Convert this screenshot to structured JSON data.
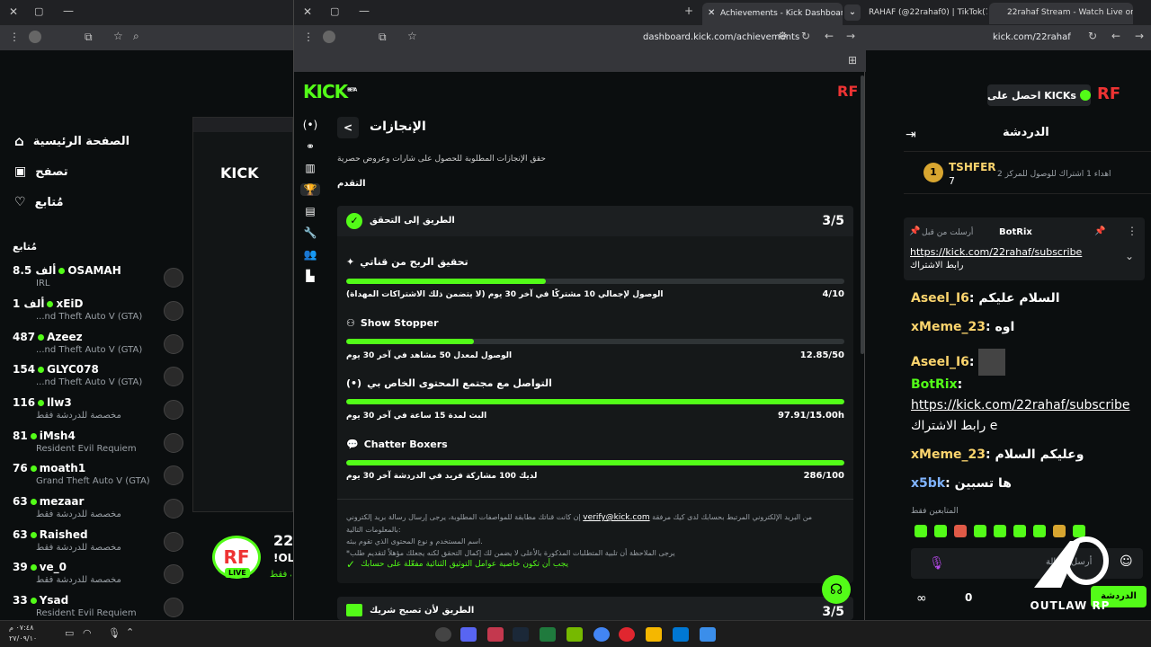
{
  "browser_back": {
    "tabs": [
      "RAHAF (@22rahaf0) | TikTok(7)",
      "22rahaf Stream - Watch Live on"
    ],
    "url": "kick.com/22rahaf"
  },
  "browser_front": {
    "tab_title": "Achievements - Kick Dashboard",
    "url": "dashboard.kick.com/achievements"
  },
  "kick": {
    "logo": "KICK",
    "beta": "BETA",
    "get_kicks_label": "احصل على KICKs",
    "channel_letters": "RF"
  },
  "left_nav": [
    {
      "label": "الصفحة الرئيسية",
      "icon": "home-icon"
    },
    {
      "label": "تصفح",
      "icon": "browse-icon"
    },
    {
      "label": "مُتابع",
      "icon": "heart-icon"
    }
  ],
  "following_title": "مُتابع",
  "following": [
    {
      "count": "8.5 ألف",
      "name": "OSAMAH",
      "sub": "IRL"
    },
    {
      "count": "1 ألف",
      "name": "xEiD",
      "sub": "...nd Theft Auto V (GTA)"
    },
    {
      "count": "487",
      "name": "Azeez",
      "sub": "...nd Theft Auto V (GTA)"
    },
    {
      "count": "154",
      "name": "GLYC078",
      "sub": "...nd Theft Auto V (GTA)"
    },
    {
      "count": "116",
      "name": "llw3",
      "sub": "مخصصة للدردشة فقط"
    },
    {
      "count": "81",
      "name": "iMsh4",
      "sub": "Resident Evil Requiem"
    },
    {
      "count": "76",
      "name": "moath1",
      "sub": "Grand Theft Auto V (GTA)"
    },
    {
      "count": "63",
      "name": "mezaar",
      "sub": "مخصصة للدردشة فقط"
    },
    {
      "count": "63",
      "name": "Raished",
      "sub": "مخصصة للدردشة فقط"
    },
    {
      "count": "39",
      "name": "ve_0",
      "sub": "مخصصة للدردشة فقط"
    },
    {
      "count": "33",
      "name": "Ysad",
      "sub": "Resident Evil Requiem"
    }
  ],
  "stream": {
    "live": "LIVE",
    "title_partial": "22",
    "sub_partial": "!OL",
    "sub2": "دقة فقط"
  },
  "page": {
    "back_label": "<",
    "title": "الإنجازات",
    "subtitle": "حقق الإنجازات المطلوبة للحصول على شارات وعروض حصرية",
    "progress_label": "التقدم"
  },
  "verify_card": {
    "title": "الطريق إلى التحقق",
    "score": "3/5",
    "achievements": [
      {
        "icon": "sparkle-icon",
        "title": "تحقيق الربح من قناتي",
        "desc": "الوصول لإجمالي 10 مشتركًا في آخر 30 يوم (لا يتضمن ذلك الاشتراكات المهداة)",
        "value": "4/10",
        "progress": 0.4
      },
      {
        "icon": "people-icon",
        "title": "Show Stopper",
        "desc": "الوصول لمعدل 50 مشاهد في آخر 30 يوم",
        "value": "12.85/50",
        "progress": 0.257
      },
      {
        "icon": "broadcast-icon",
        "title": "التواصل مع مجتمع المحتوى الخاص بي",
        "desc": "البث لمدة 15 ساعة في آخر 30 يوم",
        "value": "97.91/15.00h",
        "progress": 1.0
      },
      {
        "icon": "chat-icon",
        "title": "Chatter Boxers",
        "desc": "لديك 100 مشاركة فريد في الدردشة آخر 30 يوم",
        "value": "286/100",
        "progress": 1.0
      }
    ],
    "note_1": "إن كانت قناتك مطابقة للمواصفات المطلوبة، يرجى إرسال رسالة بريد إلكتروني",
    "note_email": "verify@kick.com",
    "note_1b": "من البريد الإلكتروني المرتبط بحسابك لدى كيك مرفقة بالمعلومات التالية:",
    "note_2": "اسم المستخدم و نوع المحتوى الذي تقوم ببثه.",
    "note_3": "*يرجى الملاحظة أن تلبية المتطلبات المذكورة بالأعلى لا يضمن لك إكمال التحقق لكنه يجعلك مؤهلاً لتقديم طلب",
    "twofa": "يجب أن تكون خاصية عوامل التوثيق الثنائية مفعّلة على حسابك"
  },
  "next_card": {
    "title": "الطريق لأن تصبح شريك",
    "score": "3/5"
  },
  "chat": {
    "title": "الدردشة",
    "top_user": "TSHFER",
    "top_count": "7",
    "top_text": "أهداء 1 اشتراك للوصول للمركز 2",
    "pinned_by": "أرسلت من قبل",
    "pinned_user": "BotRix",
    "pinned_link": "https://kick.com/22rahaf/subscribe",
    "pinned_text": "رابط الاشتراك",
    "messages": [
      {
        "user": "Aseel_I6",
        "text": "السلام عليكم",
        "color": "#fbd46d"
      },
      {
        "user": "xMeme_23",
        "text": "اوه",
        "color": "#fbd46d"
      },
      {
        "user": "Aseel_I6",
        "text": "",
        "color": "#fbd46d"
      },
      {
        "user": "BotRix",
        "text": "https://kick.com/22rahaf/subscribe",
        "color": "#53fc18"
      },
      {
        "user": "",
        "text": "رابط الاشتراك e",
        "color": "#fff"
      },
      {
        "user": "xMeme_23",
        "text": "وعليكم السلام",
        "color": "#fbd46d"
      },
      {
        "user": "x5bk",
        "text": "ها تسبين",
        "color": "#7fb3ff"
      }
    ],
    "followers_only": "المتابعين فقط",
    "input_placeholder": "أرسل رسالة",
    "send_label": "الدردشة",
    "stat_count": "0"
  },
  "watermark": {
    "text": "OUTLAW RP"
  },
  "taskbar": {
    "time": "٠٧:٤٨ م",
    "date": "٢٧/٠٩/١٠"
  }
}
